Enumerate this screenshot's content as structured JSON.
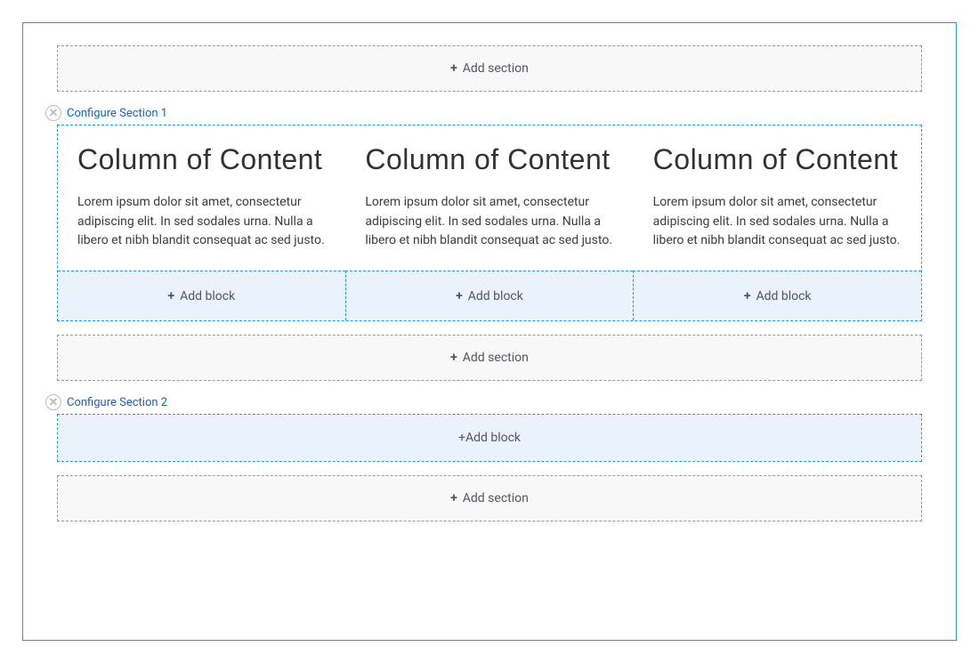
{
  "add_section_label": "Add section",
  "add_block_label": "Add block",
  "sections": {
    "0": {
      "configure_label": "Configure Section 1"
    },
    "1": {
      "configure_label": "Configure Section 2"
    }
  },
  "columns": {
    "0": {
      "title": "Column of Content",
      "body": "Lorem ipsum dolor sit amet, consectetur adipiscing elit. In sed sodales urna. Nulla a libero et nibh blandit consequat ac sed justo."
    },
    "1": {
      "title": "Column of Content",
      "body": "Lorem ipsum dolor sit amet, consectetur adipiscing elit. In sed sodales urna. Nulla a libero et nibh blandit consequat ac sed justo."
    },
    "2": {
      "title": "Column of Content",
      "body": "Lorem ipsum dolor sit amet, consectetur adipiscing elit. In sed sodales urna. Nulla a libero et nibh blandit consequat ac sed justo."
    }
  }
}
